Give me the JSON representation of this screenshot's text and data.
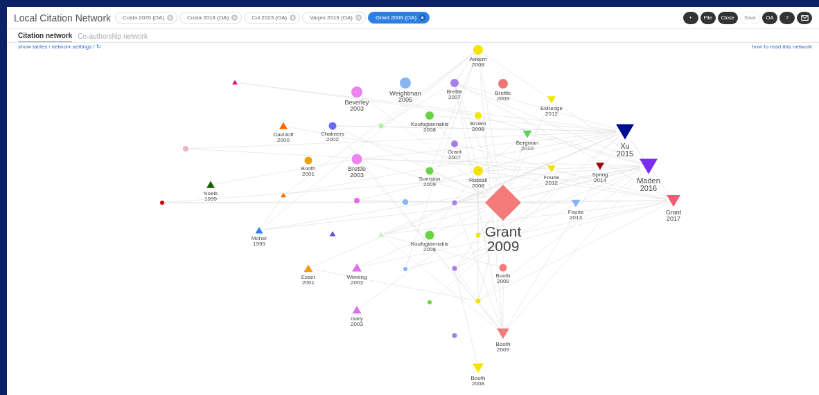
{
  "app": {
    "title": "Local Citation Network"
  },
  "tabs": [
    {
      "label": "Costa 2020 (OA)",
      "selected": false
    },
    {
      "label": "Costa 2018 (OA)",
      "selected": false
    },
    {
      "label": "Cui 2023 (OA)",
      "selected": false
    },
    {
      "label": "Varpio 2019 (OA)",
      "selected": false
    },
    {
      "label": "Grant 2009 (OA)",
      "selected": true
    }
  ],
  "toolbar": [
    {
      "kind": "filled",
      "label": "+"
    },
    {
      "kind": "filled",
      "label": "File"
    },
    {
      "kind": "filled",
      "label": "Close"
    },
    {
      "kind": "outline",
      "label": "Save"
    },
    {
      "kind": "filled",
      "label": "OA"
    },
    {
      "kind": "filled",
      "label": "?"
    },
    {
      "kind": "mail"
    }
  ],
  "views": [
    {
      "label": "Citation network",
      "selected": true
    },
    {
      "label": "Co-authorship network",
      "selected": false
    }
  ],
  "links": {
    "items": [
      "show tables",
      "network settings",
      "↻"
    ],
    "separator": "/",
    "help": "how to read this network"
  },
  "graph": {
    "nodes": [
      {
        "kind": "circle",
        "color": "#f5e400",
        "name": "Ankem",
        "year": "2008"
      },
      {
        "kind": "up",
        "color": "#e0117f"
      },
      {
        "kind": "circle",
        "color": "#ee82ee",
        "name": "Beverley",
        "year": "2003"
      },
      {
        "kind": "circle",
        "color": "#87b5f5",
        "name": "Weightman",
        "year": "2005"
      },
      {
        "kind": "circle",
        "color": "#a57ee8",
        "name": "Brettle",
        "year": "2007"
      },
      {
        "kind": "circle",
        "color": "#f07575",
        "name": "Brettle",
        "year": "2009"
      },
      {
        "kind": "down",
        "color": "#f5e400",
        "name": "Eldredge",
        "year": "2012"
      },
      {
        "kind": "circle",
        "color": "#66d444",
        "name": "Koufogiannakis",
        "year": "2008"
      },
      {
        "kind": "circle",
        "color": "#f5e400",
        "name": "Brown",
        "year": "2008"
      },
      {
        "kind": "up",
        "color": "#ff6a00",
        "name": "Davidoff",
        "year": "2000"
      },
      {
        "kind": "circle",
        "color": "#6a6af0",
        "name": "Chalmers",
        "year": "2002"
      },
      {
        "kind": "circle",
        "color": "#b6ecaa"
      },
      {
        "kind": "down",
        "color": "#5dd35d",
        "name": "Bergman",
        "year": "2010"
      },
      {
        "kind": "circle",
        "color": "#f7b3c6"
      },
      {
        "kind": "circle",
        "color": "#a57ee8",
        "name": "Grant",
        "year": "2007"
      },
      {
        "kind": "circle",
        "color": "#f5a000",
        "name": "Booth",
        "year": "2001"
      },
      {
        "kind": "circle",
        "color": "#ee82ee",
        "name": "Brettle",
        "year": "2003"
      },
      {
        "kind": "down",
        "color": "#000c8f",
        "name": "Xu",
        "year": "2015"
      },
      {
        "kind": "circle",
        "color": "#66d444",
        "name": "Sumsion",
        "year": "2009"
      },
      {
        "kind": "circle",
        "color": "#f5e400",
        "name": "Rossall",
        "year": "2008"
      },
      {
        "kind": "down",
        "color": "#f5e400",
        "name": "Fourie",
        "year": "2012"
      },
      {
        "kind": "down",
        "color": "#9e0000",
        "name": "Spring",
        "year": "2014"
      },
      {
        "kind": "down",
        "color": "#7a2ef0",
        "name": "Maden",
        "year": "2016"
      },
      {
        "kind": "up",
        "color": "#1a5e00",
        "name": "Noels",
        "year": "1999"
      },
      {
        "kind": "circle",
        "color": "#d40000"
      },
      {
        "kind": "up",
        "color": "#ff6a00"
      },
      {
        "kind": "circle",
        "color": "#ee66ee"
      },
      {
        "kind": "circle",
        "color": "#87b5f5"
      },
      {
        "kind": "circle",
        "color": "#a57ee8"
      },
      {
        "kind": "diamond",
        "color": "#f57a7a",
        "name": "Grant",
        "year": "2009"
      },
      {
        "kind": "down",
        "color": "#87b5f5",
        "name": "Fourie",
        "year": "2013"
      },
      {
        "kind": "down",
        "color": "#f55c78",
        "name": "Grant",
        "year": "2017"
      },
      {
        "kind": "up",
        "color": "#2f7ef0",
        "name": "Moher",
        "year": "1999"
      },
      {
        "kind": "up",
        "color": "#6a4ee8"
      },
      {
        "kind": "up",
        "color": "#c9f2c0"
      },
      {
        "kind": "circle",
        "color": "#66d444",
        "name": "Koufogiannakis",
        "year": "2008"
      },
      {
        "kind": "circle",
        "color": "#f5e400"
      },
      {
        "kind": "up",
        "color": "#f59a1a",
        "name": "Esser",
        "year": "2001"
      },
      {
        "kind": "up",
        "color": "#e070ee",
        "name": "Winning",
        "year": "2003"
      },
      {
        "kind": "circle",
        "color": "#87b5f5"
      },
      {
        "kind": "circle",
        "color": "#a57ee8"
      },
      {
        "kind": "circle",
        "color": "#f57a7a",
        "name": "Booth",
        "year": "2009"
      },
      {
        "kind": "up",
        "color": "#e070ee",
        "name": "Gary",
        "year": "2003"
      },
      {
        "kind": "circle",
        "color": "#66d444"
      },
      {
        "kind": "circle",
        "color": "#f5e400"
      },
      {
        "kind": "circle",
        "color": "#a57ee8"
      },
      {
        "kind": "down",
        "color": "#f57a7a",
        "name": "Booth",
        "year": "2009"
      },
      {
        "kind": "down",
        "color": "#f5e400",
        "name": "Booth",
        "year": "2008"
      }
    ]
  }
}
